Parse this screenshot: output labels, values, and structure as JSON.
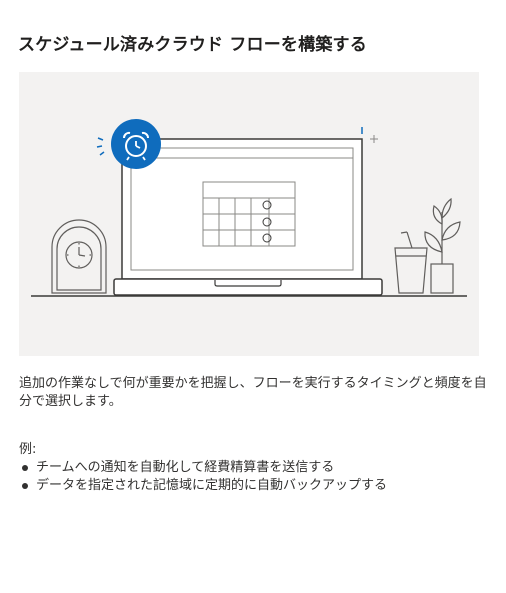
{
  "dialog": {
    "title": "スケジュール済みクラウド フローを構築する",
    "illustration": {
      "icon": "alarm-clock-icon",
      "accent_color": "#0f6cbd",
      "line_color": "#3b3a39",
      "background_color": "#f3f2f1"
    },
    "description": "追加の作業なしで何が重要かを把握し、フローを実行するタイミングと頻度を自分で選択します。",
    "examples_label": "例:",
    "examples": [
      "チームへの通知を自動化して経費精算書を送信する",
      "データを指定された記憶域に定期的に自動バックアップする"
    ]
  }
}
